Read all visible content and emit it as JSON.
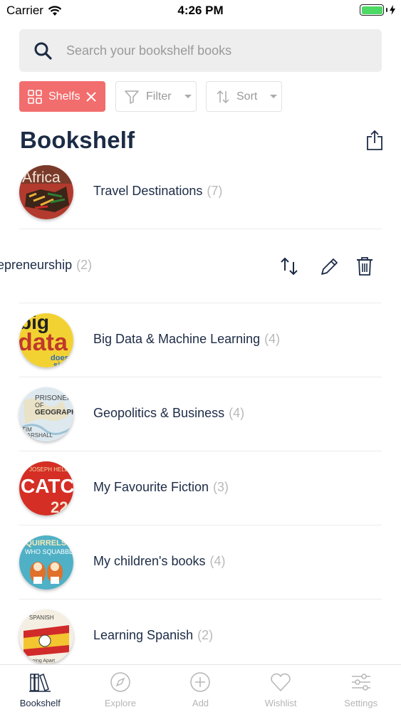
{
  "status_bar": {
    "carrier": "Carrier",
    "time": "4:26 PM"
  },
  "search": {
    "placeholder": "Search your bookshelf books"
  },
  "chips": {
    "shelfs": "Shelfs",
    "filter": "Filter",
    "sort": "Sort"
  },
  "page_title": "Bookshelf",
  "shelves": [
    {
      "name": "Travel Destinations",
      "count": "(7)",
      "cover_text": "Africa"
    },
    {
      "name": "Entrepreneurship",
      "visible_name": "epreneurship",
      "count": "(2)"
    },
    {
      "name": "Big Data & Machine Learning",
      "count": "(4)",
      "cover_text": "big data"
    },
    {
      "name": "Geopolitics & Business",
      "count": "(4)",
      "cover_text": "PRISONERS OF GEOGRAPHY"
    },
    {
      "name": "My Favourite Fiction",
      "count": "(3)",
      "cover_text": "CATCH"
    },
    {
      "name": "My children's books",
      "count": "(4)",
      "cover_text": "SQUIRRELS WHO SQUABBLED"
    },
    {
      "name": "Learning Spanish",
      "count": "(2)",
      "cover_text": "SPANISH"
    }
  ],
  "tabs": [
    {
      "label": "Bookshelf",
      "icon": "books-icon",
      "active": true
    },
    {
      "label": "Explore",
      "icon": "compass-icon",
      "active": false
    },
    {
      "label": "Add",
      "icon": "plus-circle-icon",
      "active": false
    },
    {
      "label": "Wishlist",
      "icon": "heart-icon",
      "active": false
    },
    {
      "label": "Settings",
      "icon": "sliders-icon",
      "active": false
    }
  ],
  "colors": {
    "accent": "#f26d6d",
    "text_dark": "#1c2b45",
    "muted": "#b5b5b5",
    "battery": "#4cd964"
  }
}
